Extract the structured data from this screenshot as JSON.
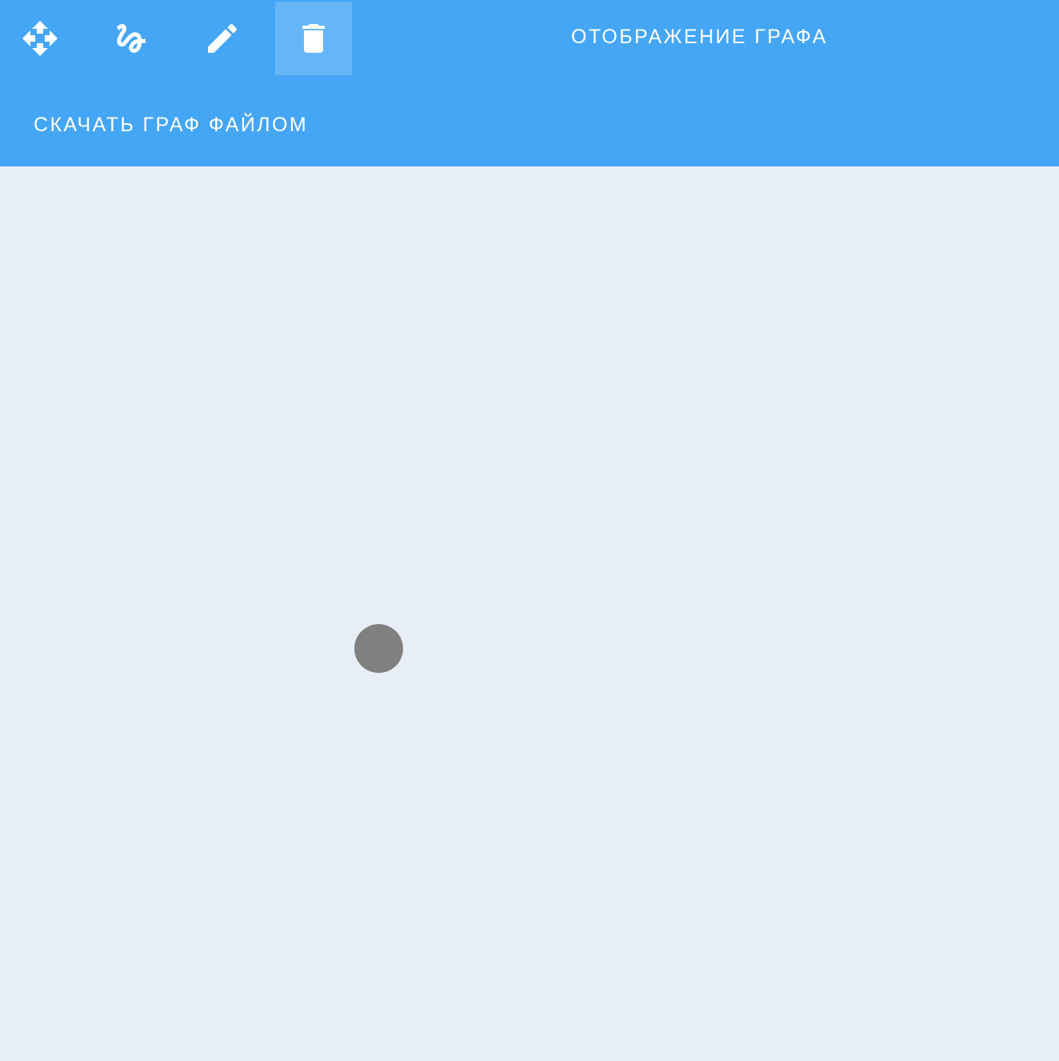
{
  "toolbar": {
    "tools": [
      {
        "name": "move",
        "icon": "move-icon"
      },
      {
        "name": "draw",
        "icon": "freehand-icon"
      },
      {
        "name": "edit",
        "icon": "pencil-icon"
      },
      {
        "name": "delete",
        "icon": "trash-icon",
        "active": true
      }
    ],
    "title": "ОТОБРАЖЕНИЕ ГРАФА",
    "download_label": "СКАЧАТЬ ГРАФ ФАЙЛОМ",
    "background_color": "#45a6f6"
  },
  "canvas": {
    "background_color": "#e7eef6",
    "vertices": [
      {
        "color": "#808080"
      }
    ]
  }
}
